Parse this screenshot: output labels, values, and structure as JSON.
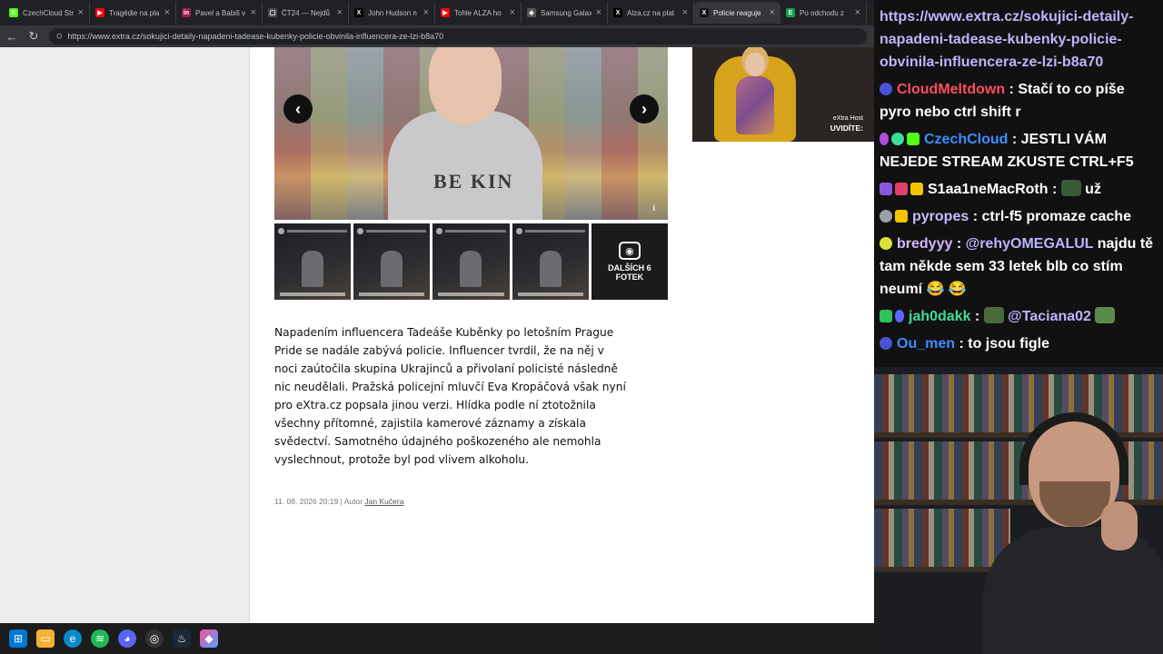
{
  "tabs": [
    {
      "label": "CzechCloud Str",
      "fav": "K",
      "fav_color": "#53fc18",
      "active": false
    },
    {
      "label": "Tragédie na pla",
      "fav": "▶",
      "fav_color": "#ff0000",
      "active": false
    },
    {
      "label": "Pavel a Babiš v",
      "fav": "in",
      "fav_color": "#9c1c4c",
      "active": false
    },
    {
      "label": "ČT24 — Nejdů",
      "fav": "▢",
      "fav_color": "#4a4a4a",
      "active": false
    },
    {
      "label": "John Hudson n",
      "fav": "X",
      "fav_color": "#000000",
      "active": false
    },
    {
      "label": "Tohle ALZA ho",
      "fav": "▶",
      "fav_color": "#ff0000",
      "active": false
    },
    {
      "label": "Samsung Galax",
      "fav": "◈",
      "fav_color": "#555555",
      "active": false
    },
    {
      "label": "Alza.cz na plat",
      "fav": "X",
      "fav_color": "#000000",
      "active": false
    },
    {
      "label": "Policie reaguje",
      "fav": "X",
      "fav_color": "#111111",
      "active": true
    },
    {
      "label": "Po odchodu z",
      "fav": "E",
      "fav_color": "#12a150",
      "active": false
    }
  ],
  "address": {
    "url": "https://www.extra.cz/sokujici-detaily-napadeni-tadease-kubenky-policie-obvinila-influencera-ze-lzi-b8a70"
  },
  "gallery": {
    "main_print": "BE KIN",
    "prev_icon": "chevron-left",
    "next_icon": "chevron-right",
    "info_glyph": "i",
    "more_label": "DALŠÍCH 6 FOTEK"
  },
  "article": {
    "body": "Napadením influencera Tadeáše Kuběnky po letošním Prague Pride se nadále zabývá policie. Influencer tvrdil, že na něj v noci zaútočila skupina Ukrajinců a přivolaní policisté následně nic neudělali. Pražská policejní mluvčí Eva Kropáčová však nyní pro eXtra.cz popsala jinou verzi. Hlídka podle ní ztotožnila všechny přítomné, zajistila kamerové záznamy a získala svědectví. Samotného údajného poškozeného ale nemohla vyslechnout, protože byl pod vlivem alkoholu.",
    "date": "11. 08. 2026 20:19",
    "author_prefix": " | Autor ",
    "author": "Jan Kučera"
  },
  "video": {
    "tag_line1": "eXtra Host",
    "tag_line2": "UVIDÍTE:"
  },
  "taskbar": {
    "icons": [
      "windows-start",
      "file-explorer",
      "edge",
      "spotify",
      "discord",
      "obs",
      "steam",
      "app"
    ]
  },
  "chat": {
    "messages": [
      {
        "nick": "",
        "nick_color": "#bcb5ff",
        "text": "https://www.extra.cz/sokujici-detaily-napadeni-tadease-kubenky-policie-obvinila-influencera-ze-lzi-b8a70"
      },
      {
        "nick": "CloudMeltdown",
        "nick_color": "#ff4d5e",
        "text": "Stačí to co píše pyro nebo ctrl shift r"
      },
      {
        "nick": "CzechCloud",
        "nick_color": "#3f8cff",
        "text": "JESTLI VÁM NEJEDE STREAM ZKUSTE CTRL+F5"
      },
      {
        "nick": "S1aa1neMacRoth",
        "nick_color": "#ffffff",
        "text": "už"
      },
      {
        "nick": "pyropes",
        "nick_color": "#c9b8ff",
        "text": "ctrl-f5 promaze cache"
      },
      {
        "nick": "bredyyy",
        "nick_color": "#d6b6ff",
        "mention": "@rehyOMEGALUL",
        "text": "najdu tě tam někde sem 33 letek blb co stím neumí 😂 😂"
      },
      {
        "nick": "jah0dakk",
        "nick_color": "#3ddc97",
        "mention": "@Taciana02",
        "text": ""
      },
      {
        "nick": "Ou_men",
        "nick_color": "#3f8cff",
        "text": "to jsou figle"
      }
    ]
  }
}
